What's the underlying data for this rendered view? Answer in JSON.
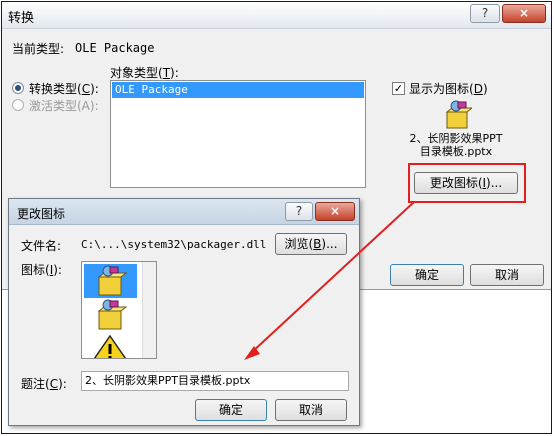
{
  "main_dialog": {
    "title": "转换",
    "help_button": "?",
    "close_button": "×",
    "current_type_label": "当前类型:",
    "current_type_value": "OLE Package",
    "object_type_label_pre": "对象类型(",
    "object_type_label_key": "T",
    "object_type_label_post": "):",
    "object_type_list": [
      "OLE Package"
    ],
    "convert_label_pre": "转换类型(",
    "convert_label_key": "C",
    "convert_label_post": "):",
    "activate_label": "激活类型(A):",
    "display_as_icon_pre": "显示为图标(",
    "display_as_icon_key": "D",
    "display_as_icon_post": ")",
    "display_as_icon_checked": "✓",
    "icon_caption_line1": "2、长阴影效果PPT",
    "icon_caption_line2": "目录模板.pptx",
    "change_icon_button_pre": "更改图标(",
    "change_icon_button_key": "I",
    "change_icon_button_post": ")...",
    "ok_button": "确定",
    "cancel_button": "取消"
  },
  "change_icon_dialog": {
    "title": "更改图标",
    "help_button": "?",
    "close_button": "×",
    "file_name_label": "文件名:",
    "file_name_value": "C:\\...\\system32\\packager.dll",
    "browse_button_pre": "浏览(",
    "browse_button_key": "B",
    "browse_button_post": ")...",
    "icon_label_pre": "图标(",
    "icon_label_key": "I",
    "icon_label_post": "):",
    "caption_label_pre": "题注(",
    "caption_label_key": "C",
    "caption_label_post": "):",
    "caption_value": "2、长阴影效果PPT目录模板.pptx",
    "ok_button": "确定",
    "cancel_button": "取消"
  },
  "colors": {
    "highlight_box": "#e02020",
    "annotation_arrow": "#e02020",
    "selection": "#3399ff"
  }
}
